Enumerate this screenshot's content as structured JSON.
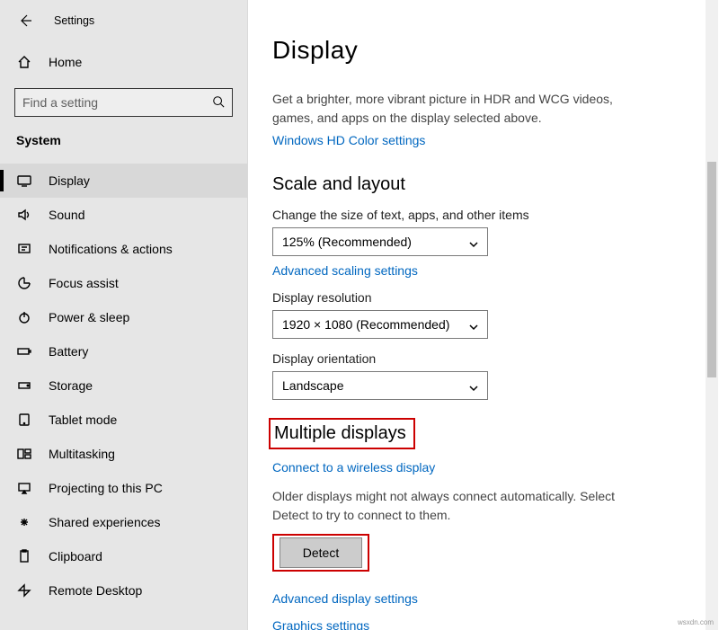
{
  "window": {
    "title": "Settings"
  },
  "sidebar": {
    "home": "Home",
    "search_placeholder": "Find a setting",
    "category": "System",
    "items": [
      {
        "label": "Display"
      },
      {
        "label": "Sound"
      },
      {
        "label": "Notifications & actions"
      },
      {
        "label": "Focus assist"
      },
      {
        "label": "Power & sleep"
      },
      {
        "label": "Battery"
      },
      {
        "label": "Storage"
      },
      {
        "label": "Tablet mode"
      },
      {
        "label": "Multitasking"
      },
      {
        "label": "Projecting to this PC"
      },
      {
        "label": "Shared experiences"
      },
      {
        "label": "Clipboard"
      },
      {
        "label": "Remote Desktop"
      }
    ]
  },
  "main": {
    "title": "Display",
    "hdr_desc": "Get a brighter, more vibrant picture in HDR and WCG videos, games, and apps on the display selected above.",
    "hdr_link": "Windows HD Color settings",
    "scale_heading": "Scale and layout",
    "scale_label": "Change the size of text, apps, and other items",
    "scale_value": "125% (Recommended)",
    "scale_adv_link": "Advanced scaling settings",
    "resolution_label": "Display resolution",
    "resolution_value": "1920 × 1080 (Recommended)",
    "orientation_label": "Display orientation",
    "orientation_value": "Landscape",
    "multi_heading": "Multiple displays",
    "wireless_link": "Connect to a wireless display",
    "detect_desc": "Older displays might not always connect automatically. Select Detect to try to connect to them.",
    "detect_button": "Detect",
    "adv_display_link": "Advanced display settings",
    "graphics_link": "Graphics settings"
  },
  "watermark": "wsxdn.com"
}
